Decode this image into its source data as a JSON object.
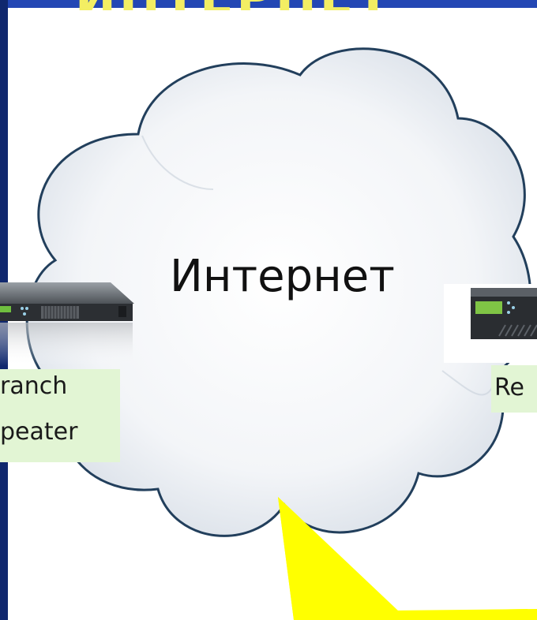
{
  "slide": {
    "title_fragment": "ИНТЕРНЕТ",
    "cloud_label": "Интернет"
  },
  "devices": {
    "branch": {
      "line1": "ranch",
      "line2": "peater"
    },
    "remote": {
      "label": "Re"
    }
  },
  "colors": {
    "slide_blue": "#1e3fa6",
    "title_yellow": "#f3ee63",
    "callout_yellow": "#ffff00",
    "label_green": "#e2f5d4"
  }
}
